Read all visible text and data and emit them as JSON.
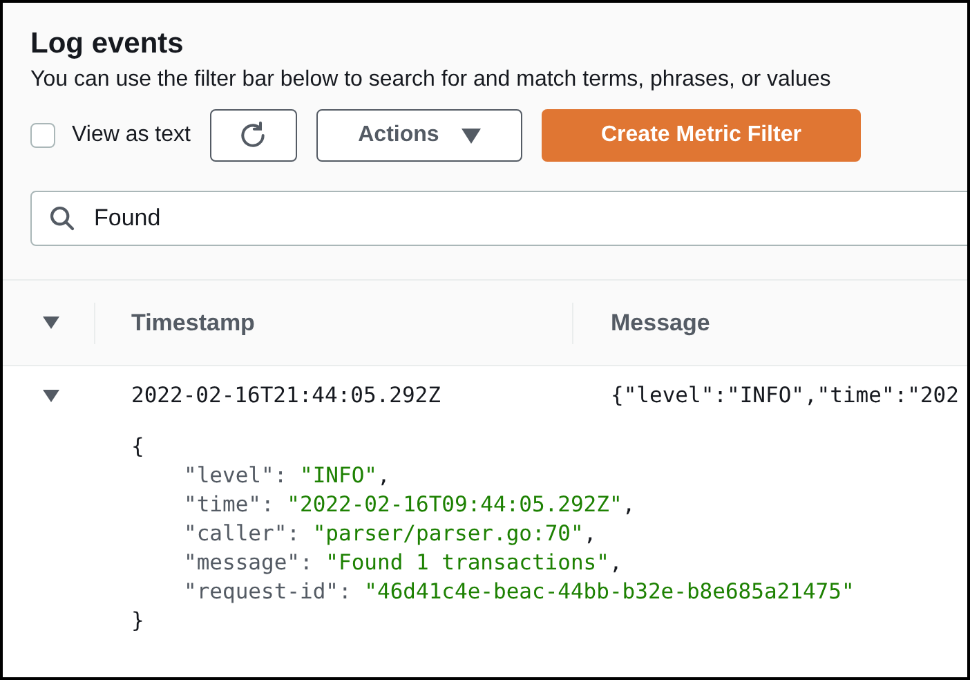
{
  "header": {
    "title": "Log events",
    "description": "You can use the filter bar below to search for and match terms, phrases, or values"
  },
  "toolbar": {
    "view_as_text": {
      "label": "View as text",
      "checked": false
    },
    "actions": {
      "label": "Actions"
    },
    "create_metric_filter": {
      "label": "Create Metric Filter"
    }
  },
  "search": {
    "value": "Found"
  },
  "table": {
    "columns": [
      "Timestamp",
      "Message"
    ],
    "rows": [
      {
        "expanded": true,
        "timestamp": "2022-02-16T21:44:05.292Z",
        "message": "{\"level\":\"INFO\",\"time\":\"202",
        "detail": {
          "open": "{",
          "close": "}",
          "fields": [
            {
              "key": "\"level\":",
              "value": "\"INFO\"",
              "trail": ","
            },
            {
              "key": "\"time\":",
              "value": "\"2022-02-16T09:44:05.292Z\"",
              "trail": ","
            },
            {
              "key": "\"caller\":",
              "value": "\"parser/parser.go:70\"",
              "trail": ","
            },
            {
              "key": "\"message\":",
              "value": "\"Found 1 transactions\"",
              "trail": ","
            },
            {
              "key": "\"request-id\":",
              "value": "\"46d41c4e-beac-44bb-b32e-b8e685a21475\""
            }
          ]
        }
      }
    ]
  }
}
